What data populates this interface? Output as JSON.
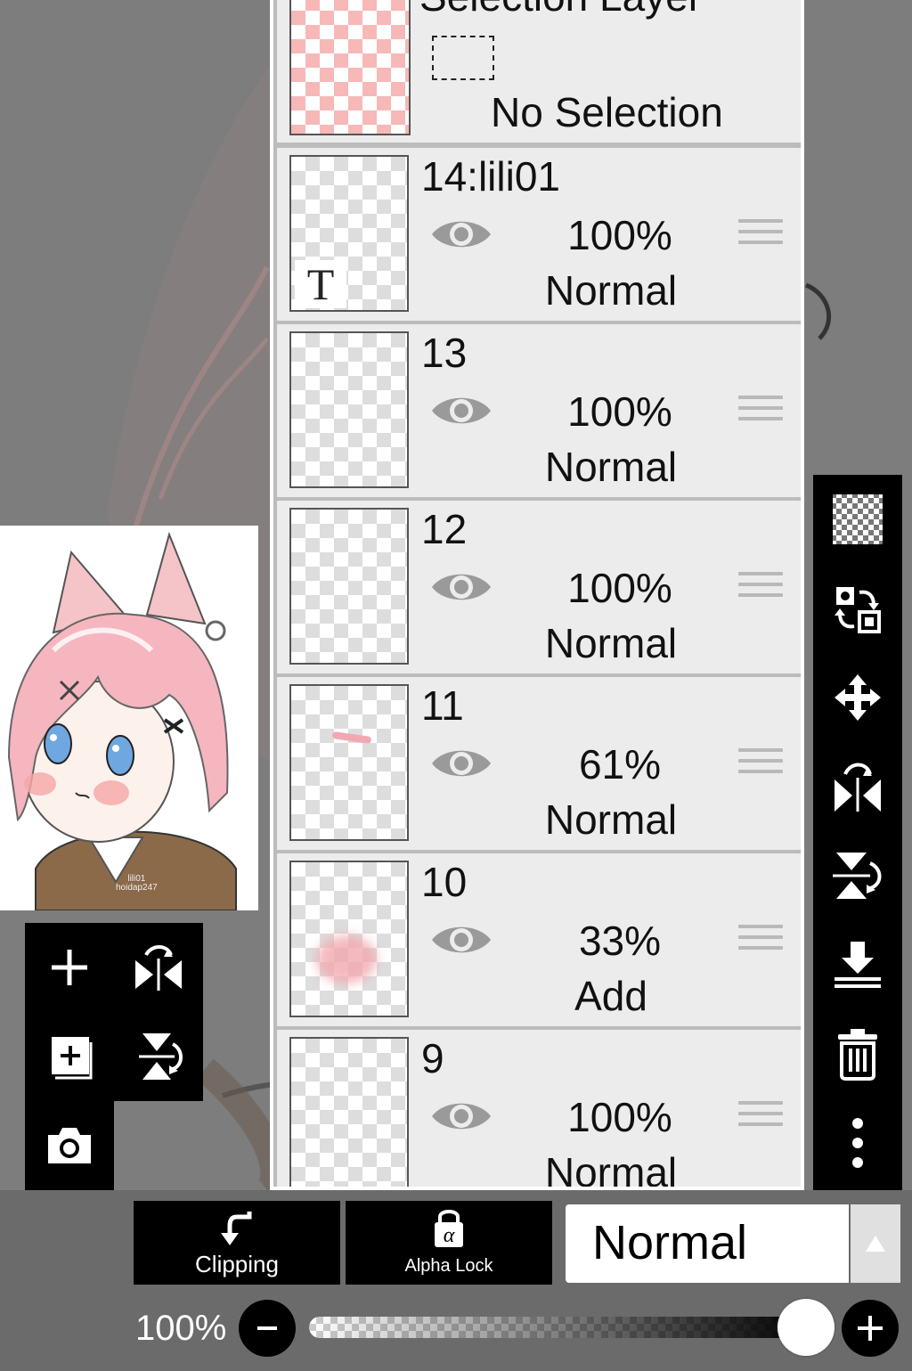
{
  "selection_layer": {
    "title": "Selection Layer",
    "status": "No Selection"
  },
  "layers": [
    {
      "name": "14:lili01",
      "opacity": "100%",
      "blend": "Normal",
      "text_badge": "T"
    },
    {
      "name": "13",
      "opacity": "100%",
      "blend": "Normal"
    },
    {
      "name": "12",
      "opacity": "100%",
      "blend": "Normal"
    },
    {
      "name": "11",
      "opacity": "61%",
      "blend": "Normal"
    },
    {
      "name": "10",
      "opacity": "33%",
      "blend": "Add"
    },
    {
      "name": "9",
      "opacity": "100%",
      "blend": "Normal"
    }
  ],
  "preview": {
    "signature_line1": "lili01",
    "signature_line2": "hoidap247"
  },
  "left_tools": [
    "add-layer-icon",
    "flip-horizontal-icon",
    "add-copy-layer-icon",
    "flip-vertical-icon",
    "camera-icon"
  ],
  "right_tools": [
    "transparent-bg-icon",
    "swap-icon",
    "move-icon",
    "flip-horizontal-icon",
    "flip-vertical-icon",
    "merge-down-icon",
    "trash-icon",
    "more-vert-icon"
  ],
  "bottom_bar": {
    "clipping_label": "Clipping",
    "alpha_lock_label": "Alpha Lock",
    "blend_mode": "Normal",
    "opacity_label": "100%",
    "opacity_value": 1.0
  },
  "colors": {
    "panel_bg": "#ececec",
    "toolbar_bg": "#000000",
    "backdrop": "#7d7d7d"
  }
}
